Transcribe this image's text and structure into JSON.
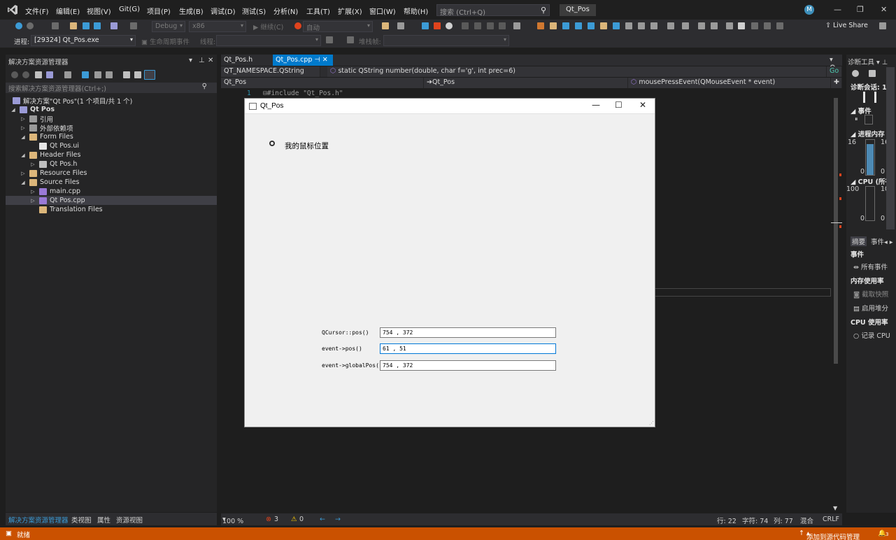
{
  "menu": {
    "items": [
      "文件(F)",
      "编辑(E)",
      "视图(V)",
      "Git(G)",
      "项目(P)",
      "生成(B)",
      "调试(D)",
      "测试(S)",
      "分析(N)",
      "工具(T)",
      "扩展(X)",
      "窗口(W)",
      "帮助(H)"
    ],
    "search_placeholder": "搜索 (Ctrl+Q)",
    "solution_title": "Qt_Pos",
    "avatar_letter": "M",
    "live_share": "Live Share"
  },
  "toolbar": {
    "config": "Debug",
    "platform": "x86",
    "continue": "继续(C)",
    "auto": "自动",
    "process_label": "进程:",
    "process_value": "[29324] Qt_Pos.exe",
    "lifecycle": "生命周期事件",
    "thread_label": "线程:",
    "stack_label": "堆栈帧:"
  },
  "solution_explorer": {
    "title": "解决方案资源管理器",
    "search_placeholder": "搜索解决方案资源管理器(Ctrl+;)",
    "tree": [
      {
        "label": "解决方案\"Qt Pos\"(1 个项目/共 1 个)"
      },
      {
        "label": "Qt Pos"
      },
      {
        "label": "引用"
      },
      {
        "label": "外部依赖项"
      },
      {
        "label": "Form Files"
      },
      {
        "label": "Qt Pos.ui"
      },
      {
        "label": "Header Files"
      },
      {
        "label": "Qt Pos.h"
      },
      {
        "label": "Resource Files"
      },
      {
        "label": "Source Files"
      },
      {
        "label": "main.cpp"
      },
      {
        "label": "Qt Pos.cpp"
      },
      {
        "label": "Translation Files"
      }
    ],
    "bottom_tabs": [
      "解决方案资源管理器",
      "类视图",
      "属性",
      "资源视图"
    ]
  },
  "editor": {
    "tabs": [
      "Qt_Pos.h",
      "Qt_Pos.cpp"
    ],
    "nav1_scope": "QT_NAMESPACE.QString",
    "nav1_member": "static QString number(double, char f='g', int prec=6)",
    "nav1_go": "Go",
    "nav2_project": "Qt_Pos",
    "nav2_class": "Qt_Pos",
    "nav2_member": "mousePressEvent(QMouseEvent * event)",
    "line_number": "1",
    "line_text": "⊟#include \"Qt_Pos.h\"",
    "status": {
      "zoom": "100 %",
      "errors": "3",
      "warnings": "0",
      "line": "行: 22",
      "char": "字符: 74",
      "col": "列: 77",
      "mixed": "混合",
      "eol": "CRLF"
    }
  },
  "qt_window": {
    "title": "Qt_Pos",
    "radio_label": "我的鼠标位置",
    "rows": [
      {
        "label": "QCursor::pos()",
        "value": "754 , 372"
      },
      {
        "label": "event->pos()",
        "value": "61 , 51"
      },
      {
        "label": "event->globalPos()",
        "value": "754 , 372"
      }
    ]
  },
  "diagnostics": {
    "title": "诊断工具",
    "session": "诊断会话: 1",
    "events": "事件",
    "process_memory": "进程内存 (",
    "mem_top_left": "16",
    "mem_top_right": "16",
    "mem_bot_left": "0",
    "mem_bot_right": "0",
    "cpu": "CPU (所有",
    "cpu_top_left": "100",
    "cpu_top_right": "10",
    "cpu_bot_left": "0",
    "cpu_bot_right": "0",
    "tab_summary": "摘要",
    "tab_events": "事件",
    "events_header": "事件",
    "all_events": "所有事件",
    "memory_usage": "内存使用率",
    "take_snapshot": "截取快照",
    "heap_profiling": "启用堆分",
    "cpu_usage": "CPU 使用率",
    "record_cpu": "记录 CPU"
  },
  "statusbar": {
    "ready": "就绪",
    "source_control": "添加到源代码管理",
    "notifications": "3"
  },
  "colors": {
    "accent": "#ca5100",
    "selection": "#0078d7"
  }
}
